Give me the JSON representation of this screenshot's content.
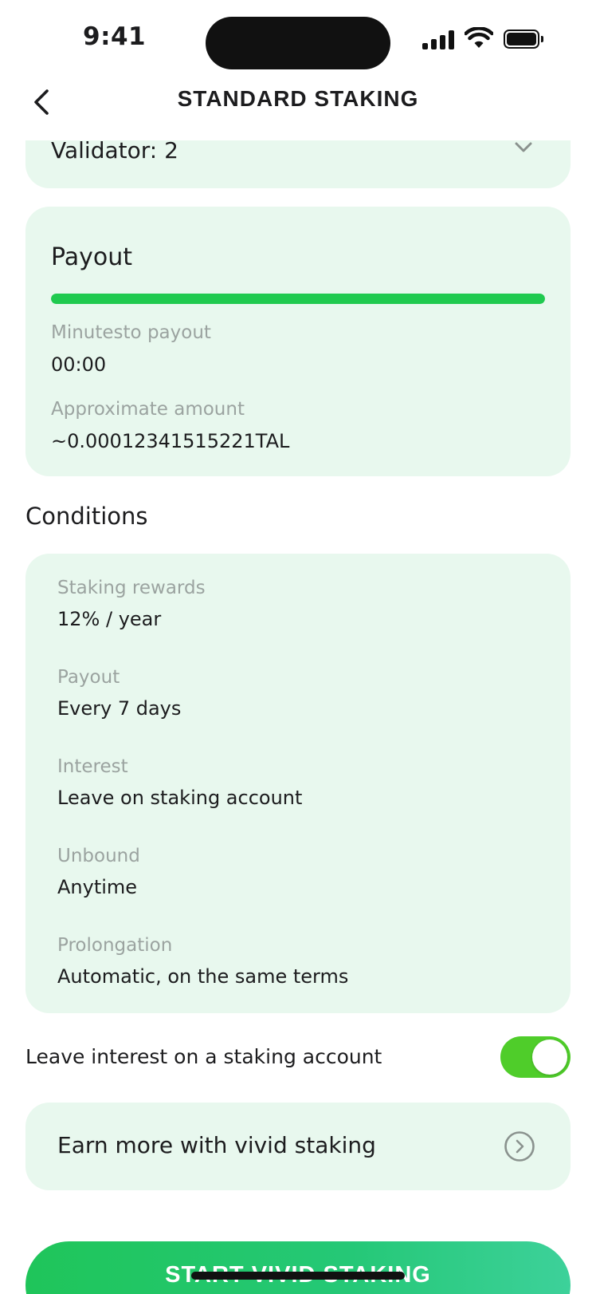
{
  "status_bar": {
    "time": "9:41"
  },
  "header": {
    "title": "STANDARD STAKING"
  },
  "validator": {
    "text": "Validator: 2"
  },
  "payout": {
    "title": "Payout",
    "progress_fraction": 1.0,
    "minutes_label": "Minutesto payout",
    "minutes_value": "00:00",
    "amount_label": "Approximate amount",
    "amount_value": "~0.00012341515221TAL"
  },
  "conditions": {
    "title": "Conditions",
    "items": [
      {
        "label": "Staking rewards",
        "value": "12% / year"
      },
      {
        "label": "Payout",
        "value": "Every 7 days"
      },
      {
        "label": "Interest",
        "value": "Leave on staking account"
      },
      {
        "label": "Unbound",
        "value": "Anytime"
      },
      {
        "label": "Prolongation",
        "value": "Automatic, on the same terms"
      }
    ]
  },
  "toggle": {
    "label": "Leave interest on a staking account",
    "on": true
  },
  "vivid": {
    "text": "Earn more with vivid staking"
  },
  "cta": {
    "label": "START VIVID STAKING"
  },
  "colors": {
    "accent": "#1fca4f",
    "card_bg": "#e8f8ee",
    "toggle_on": "#4fcd2a"
  }
}
